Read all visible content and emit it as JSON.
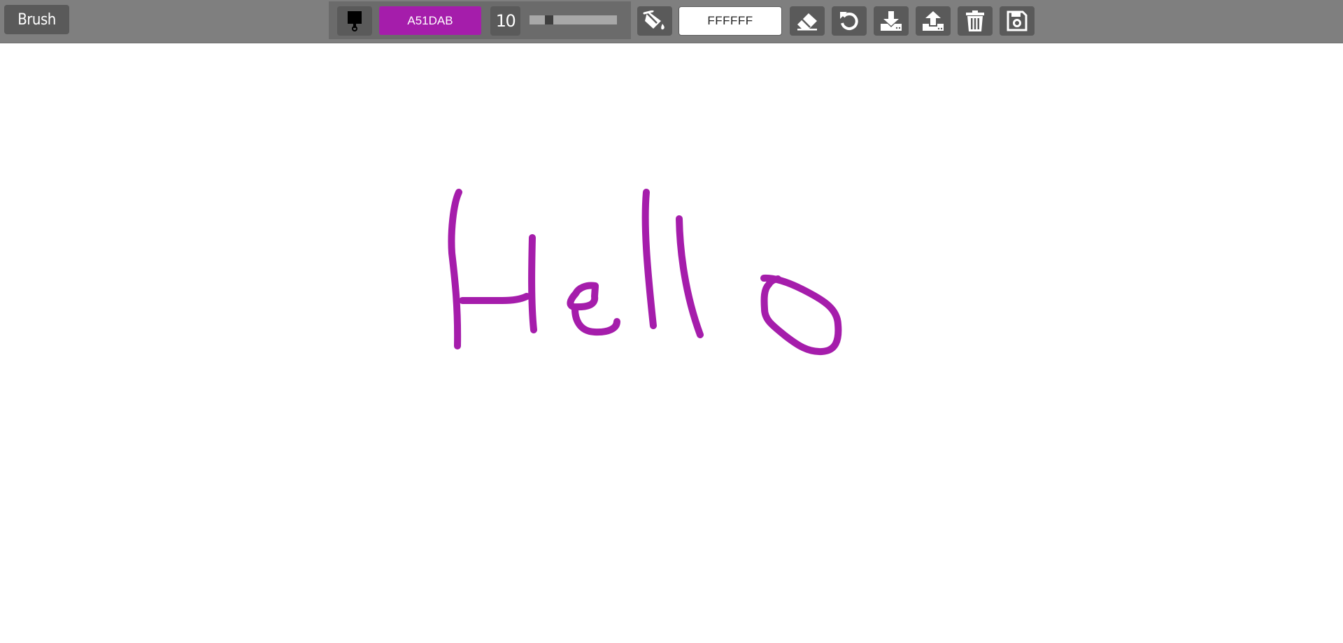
{
  "toolbar": {
    "mode_label": "Brush",
    "brush_color_hex": "A51DAB",
    "brush_size": "10",
    "brush_size_fraction": 0.22,
    "background_color_hex": "FFFFFF"
  },
  "icons": {
    "brush": "paint-brush-icon",
    "fill": "fill-bucket-icon",
    "eraser": "eraser-icon",
    "undo": "undo-icon",
    "download": "download-icon",
    "upload": "upload-icon",
    "delete": "trash-icon",
    "save": "floppy-disk-icon"
  },
  "colors": {
    "stroke": "#A51DAB",
    "toolbar": "#7F7F7F",
    "button": "#5A5A5A",
    "canvas": "#FFFFFF"
  },
  "canvas": {
    "drawing_text": "Hello"
  }
}
